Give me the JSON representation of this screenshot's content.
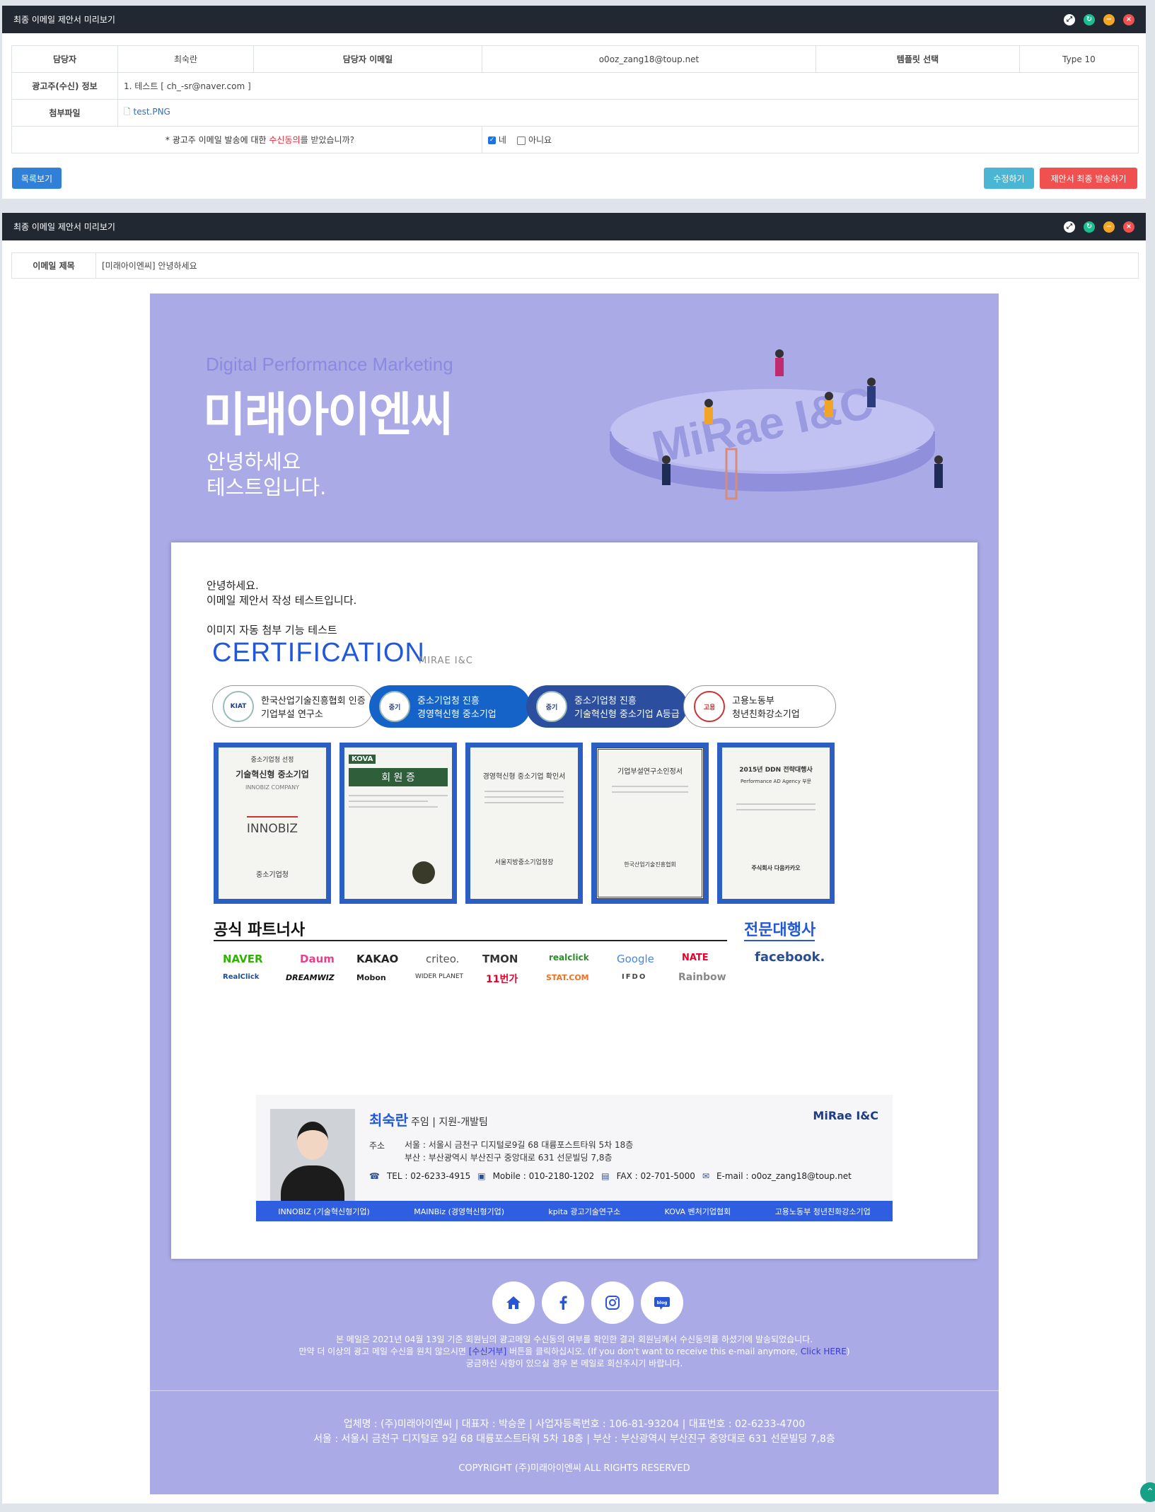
{
  "panel1": {
    "title": "최종 이메일 제안서 미리보기",
    "manager_label": "담당자",
    "manager_value": "최숙란",
    "manager_email_label": "담당자 이메일",
    "manager_email_value": "o0oz_zang18@toup.net",
    "template_label": "템플릿 선택",
    "template_value": "Type 10",
    "advertiser_label": "광고주(수신) 정보",
    "advertiser_value": "1. 테스트 [ ch_-sr@naver.com ]",
    "attach_label": "첨부파일",
    "attach_value": "test.PNG",
    "consent_prefix": "* 광고주 이메일 발송에 대한 ",
    "consent_highlight": "수신동의",
    "consent_suffix": "를 받았습니까?",
    "yes_label": "네",
    "no_label": "아니요",
    "list_button": "목록보기",
    "edit_button": "수정하기",
    "send_button": "제안서 최종 발송하기"
  },
  "panel2": {
    "title": "최종 이메일 제안서 미리보기",
    "subject_label": "이메일 제목",
    "subject_value": "[미래아이엔씨] 안녕하세요"
  },
  "email": {
    "hero_sub": "Digital Performance Marketing",
    "hero_title": "미래아이엔씨",
    "hero_greeting": "안녕하세요\n테스트입니다.",
    "hero_logo_text": "MiRae I&C",
    "body_line1": "안녕하세요.",
    "body_line2": "이메일 제안서 작성 테스트입니다.",
    "image_test": "이미지 자동 첨부 기능 테스트",
    "cert_title": "CERTIFICATION",
    "cert_sub": "MIRAE I&C",
    "pills": [
      {
        "seal": "KIAT",
        "line1": "한국산업기술진흥협회 인증",
        "line2": "기업부설 연구소"
      },
      {
        "seal": "중기",
        "line1": "중소기업청 진흥",
        "line2": "경영혁신형 중소기업"
      },
      {
        "seal": "중기",
        "line1": "중소기업청 진흥",
        "line2": "기술혁신형 중소기업 A등급"
      },
      {
        "seal": "고용",
        "line1": "고용노동부",
        "line2": "청년친화강소기업"
      }
    ],
    "docs": [
      {
        "top": "중소기업청 선정",
        "main": "기술혁신형 중소기업",
        "sub": "INNOBIZ COMPANY",
        "mark": "INNOBIZ",
        "foot": "중소기업청"
      },
      {
        "top": "KOVA",
        "main": "회 원 증",
        "sub": "",
        "mark": "",
        "foot": ""
      },
      {
        "top": "",
        "main": "경영혁신형 중소기업 확인서",
        "sub": "",
        "mark": "",
        "foot": "서울지방중소기업청장"
      },
      {
        "top": "",
        "main": "기업부설연구소인정서",
        "sub": "",
        "mark": "",
        "foot": "한국산업기술진흥협회"
      },
      {
        "top": "2015년 DDN 전략대행사",
        "main": "Performance AD Agency 부문",
        "sub": "",
        "mark": "",
        "foot": "주식회사 다음카카오"
      }
    ],
    "partners_title": "공식 파트너사",
    "agency_title": "전문대행사",
    "partners_row1": [
      "NAVER",
      "Daum",
      "KAKAO",
      "criteo.",
      "TMON",
      "realclick",
      "Google",
      "NATE"
    ],
    "partners_row2": [
      "RealClick",
      "DREAMWIZ",
      "Mobon",
      "WIDER PLANET",
      "11번가",
      "STAT.COM",
      "IFDO",
      "Rainbow"
    ],
    "agency_logo": "facebook.",
    "signature": {
      "name": "최숙란",
      "title": "주임 | 지원-개발팀",
      "addr_label": "주소",
      "addr1": "서울 : 서울시 금천구 디지털로9길 68 대륭포스트타워 5차 18층",
      "addr2": "부산 : 부산광역시 부산진구 중앙대로 631 선문빌딩 7,8층",
      "tel": "TEL : 02-6233-4915",
      "mobile": "Mobile : 010-2180-1202",
      "fax": "FAX : 02-701-5000",
      "email": "E-mail : o0oz_zang18@toup.net",
      "logo": "MiRae I&C",
      "bar": [
        "INNOBIZ (기술혁신형기업)",
        "MAINBiz (경영혁신형기업)",
        "kpita 광고기술연구소",
        "KOVA 벤처기업협회",
        "고용노동부 청년친화강소기업"
      ]
    },
    "footer_line1": "본 메일은 2021년 04월 13일 기준 회원님의 광고메일 수신동의 여부를 확인한 결과 회원님께서 수신동의를 하셨기에 발송되었습니다.",
    "footer_line2a": "만약 더 이상의 광고 메일 수신을 원치 않으시면 ",
    "footer_line2b": "[수신거부]",
    "footer_line2c": " 버튼을 클릭하십시오. (If you don't want to receive this e-mail anymore, ",
    "footer_line2d": "Click HERE",
    "footer_line2e": ")",
    "footer_line3": "궁금하신 사항이 있으실 경우 본 메일로 회신주시기 바랍니다.",
    "company_line1": "업체명 : (주)미래아이엔씨 | 대표자 : 박승운 | 사업자등록번호 : 106-81-93204 | 대표번호 : 02-6233-4700",
    "company_line2": "서울 : 서울시 금천구 디지털로 9길 68 대륭포스트타워 5차 18층 | 부산 : 부산광역시 부산진구 중앙대로 631 선문빌딩 7,8층",
    "copyright": "COPYRIGHT (주)미래아이엔씨 ALL RIGHTS RESERVED",
    "sns": [
      "home-icon",
      "facebook-icon",
      "instagram-icon",
      "blog-icon"
    ],
    "blog_label": "blog"
  },
  "colors": {
    "header": "#212831",
    "primary": "#2f80d6",
    "info": "#4bb6d3",
    "danger": "#f05050",
    "email_bg": "#aaaae6",
    "accent": "#2258d8"
  }
}
